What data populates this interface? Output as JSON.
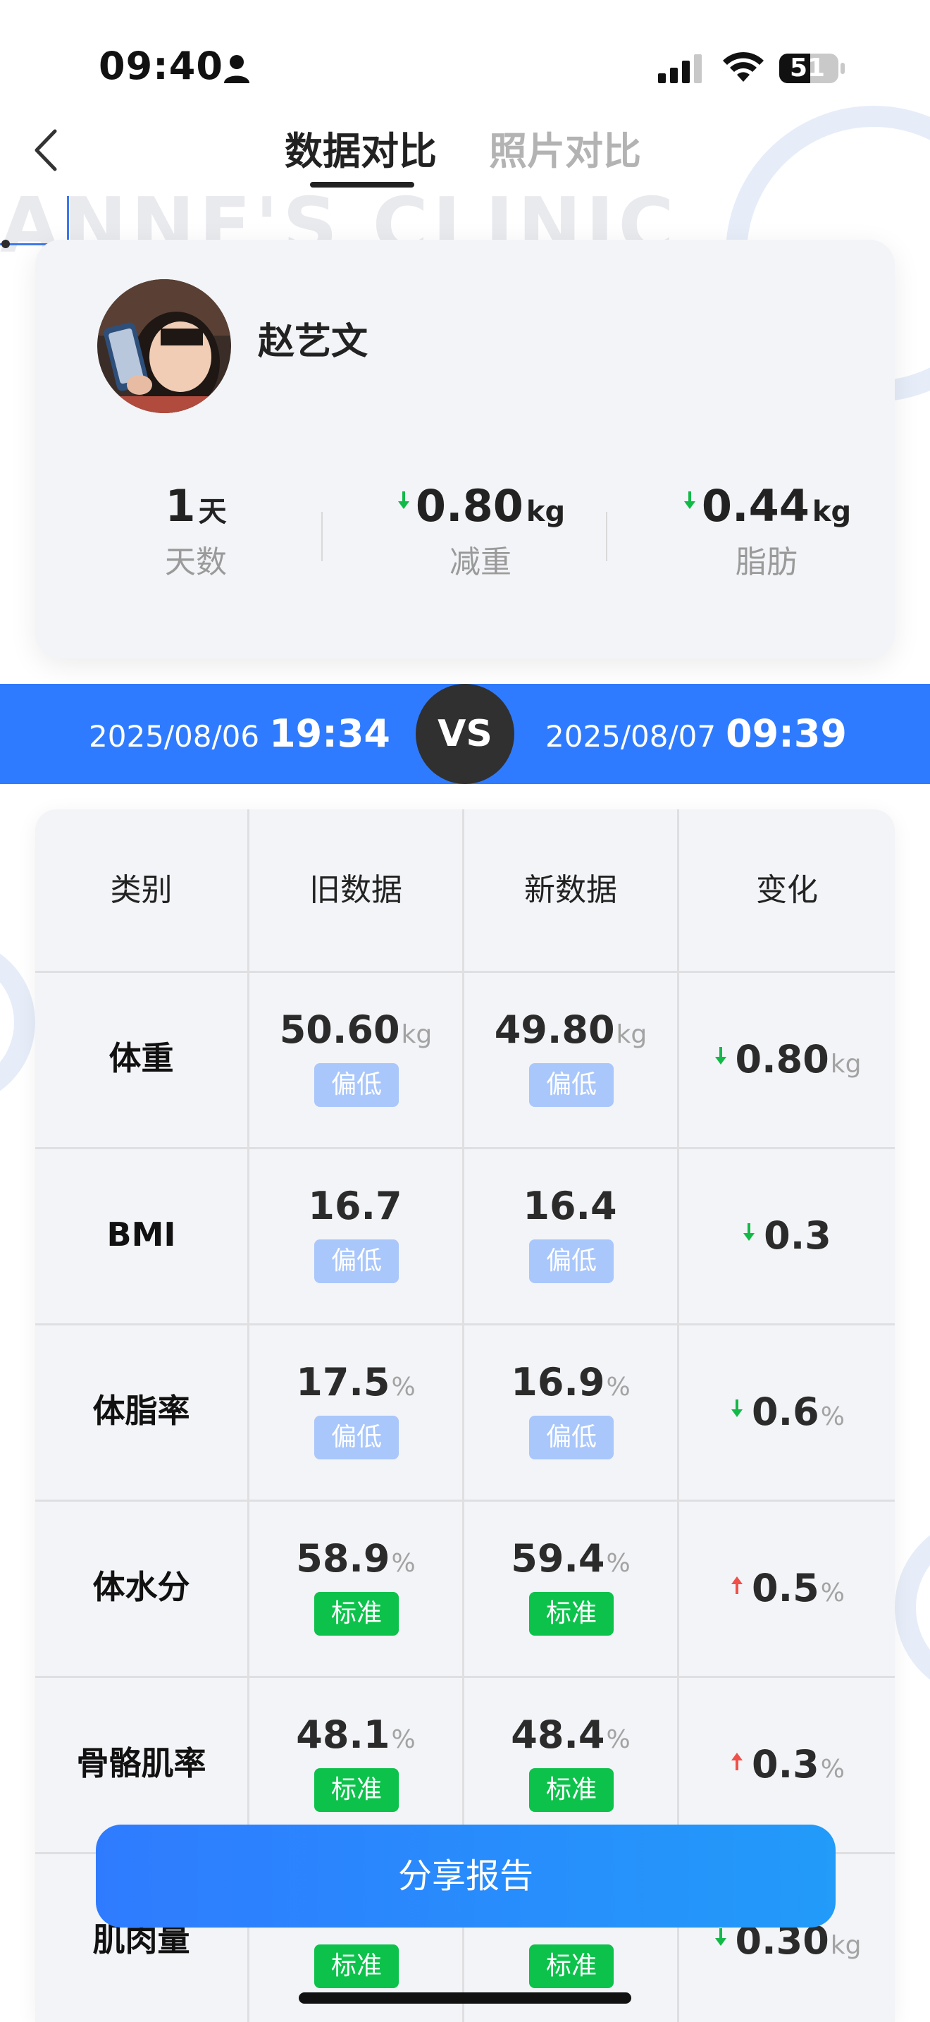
{
  "status_bar": {
    "time": "09:40",
    "battery": "51"
  },
  "nav": {
    "tabs": [
      {
        "label": "数据对比",
        "active": true
      },
      {
        "label": "照片对比",
        "active": false
      }
    ]
  },
  "background": {
    "watermark": "ANNE'S CLINIC"
  },
  "profile": {
    "name": "赵艺文",
    "stats": [
      {
        "value": "1",
        "unit": "天",
        "label": "天数",
        "arrow": ""
      },
      {
        "value": "0.80",
        "unit": "kg",
        "label": "减重",
        "arrow": "down"
      },
      {
        "value": "0.44",
        "unit": "kg",
        "label": "脂肪",
        "arrow": "down"
      }
    ]
  },
  "compare": {
    "old_date": "2025/08/06",
    "old_time": "19:34",
    "vs": "VS",
    "new_date": "2025/08/07",
    "new_time": "09:39"
  },
  "table": {
    "headers": [
      "类别",
      "旧数据",
      "新数据",
      "变化"
    ],
    "rows": [
      {
        "category": "体重",
        "old": "50.60",
        "old_unit": "kg",
        "old_status": "偏低",
        "new": "49.80",
        "new_unit": "kg",
        "new_status": "偏低",
        "change": "0.80",
        "change_unit": "kg",
        "direction": "down"
      },
      {
        "category": "BMI",
        "old": "16.7",
        "old_unit": "",
        "old_status": "偏低",
        "new": "16.4",
        "new_unit": "",
        "new_status": "偏低",
        "change": "0.3",
        "change_unit": "",
        "direction": "down"
      },
      {
        "category": "体脂率",
        "old": "17.5",
        "old_unit": "%",
        "old_status": "偏低",
        "new": "16.9",
        "new_unit": "%",
        "new_status": "偏低",
        "change": "0.6",
        "change_unit": "%",
        "direction": "down"
      },
      {
        "category": "体水分",
        "old": "58.9",
        "old_unit": "%",
        "old_status": "标准",
        "new": "59.4",
        "new_unit": "%",
        "new_status": "标准",
        "change": "0.5",
        "change_unit": "%",
        "direction": "up"
      },
      {
        "category": "骨骼肌率",
        "old": "48.1",
        "old_unit": "%",
        "old_status": "标准",
        "new": "48.4",
        "new_unit": "%",
        "new_status": "标准",
        "change": "0.3",
        "change_unit": "%",
        "direction": "up"
      },
      {
        "category": "肌肉量",
        "old": "",
        "old_unit": "",
        "old_status": "标准",
        "new": "",
        "new_unit": "",
        "new_status": "标准",
        "change": "0.30",
        "change_unit": "kg",
        "direction": "down"
      }
    ]
  },
  "share_button": {
    "label": "分享报告"
  },
  "colors": {
    "accent": "#2f7bff",
    "normal_badge": "#0dc24b",
    "low_badge": "#a9c7fb",
    "down_arrow": "#13b948",
    "up_arrow": "#f0504a"
  }
}
